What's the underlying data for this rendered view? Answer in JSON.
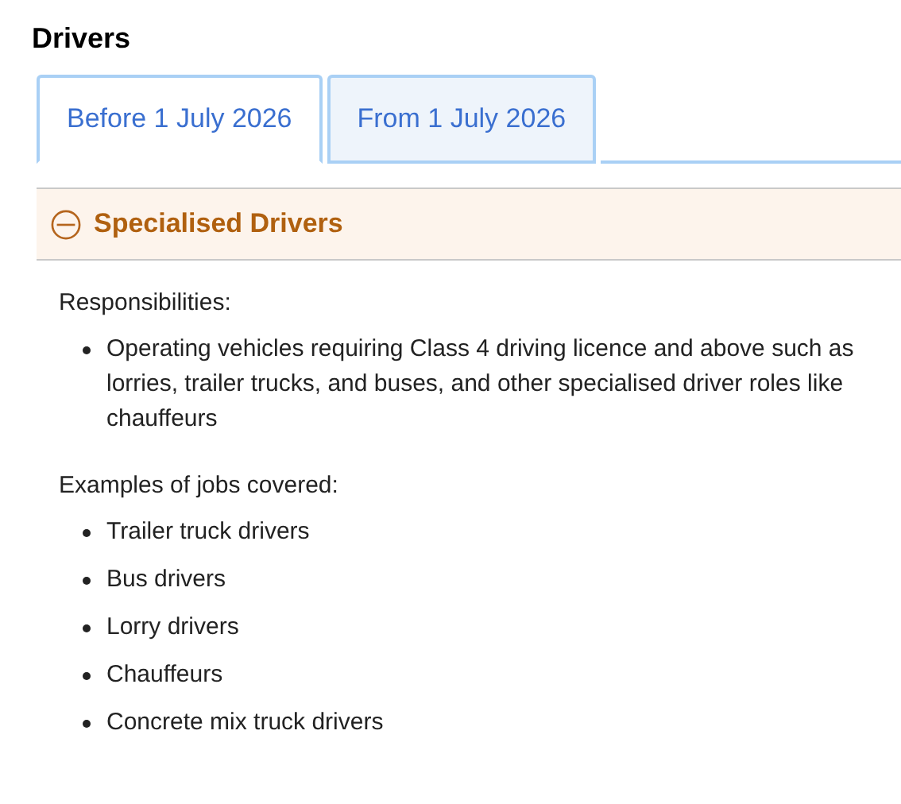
{
  "title": "Drivers",
  "tabs": [
    {
      "label": "Before 1 July 2026",
      "selected": true
    },
    {
      "label": "From 1 July 2026",
      "selected": false
    }
  ],
  "accordion": {
    "title": "Specialised Drivers",
    "expanded": true,
    "sections": [
      {
        "heading": "Responsibilities:",
        "items": [
          "Operating vehicles requiring Class 4 driving licence and above such as lorries, trailer trucks, and buses, and other specialised driver roles like chauffeurs"
        ]
      },
      {
        "heading": "Examples of jobs covered:",
        "items": [
          "Trailer truck drivers",
          "Bus drivers",
          "Lorry drivers",
          "Chauffeurs",
          "Concrete mix truck drivers"
        ]
      }
    ]
  }
}
